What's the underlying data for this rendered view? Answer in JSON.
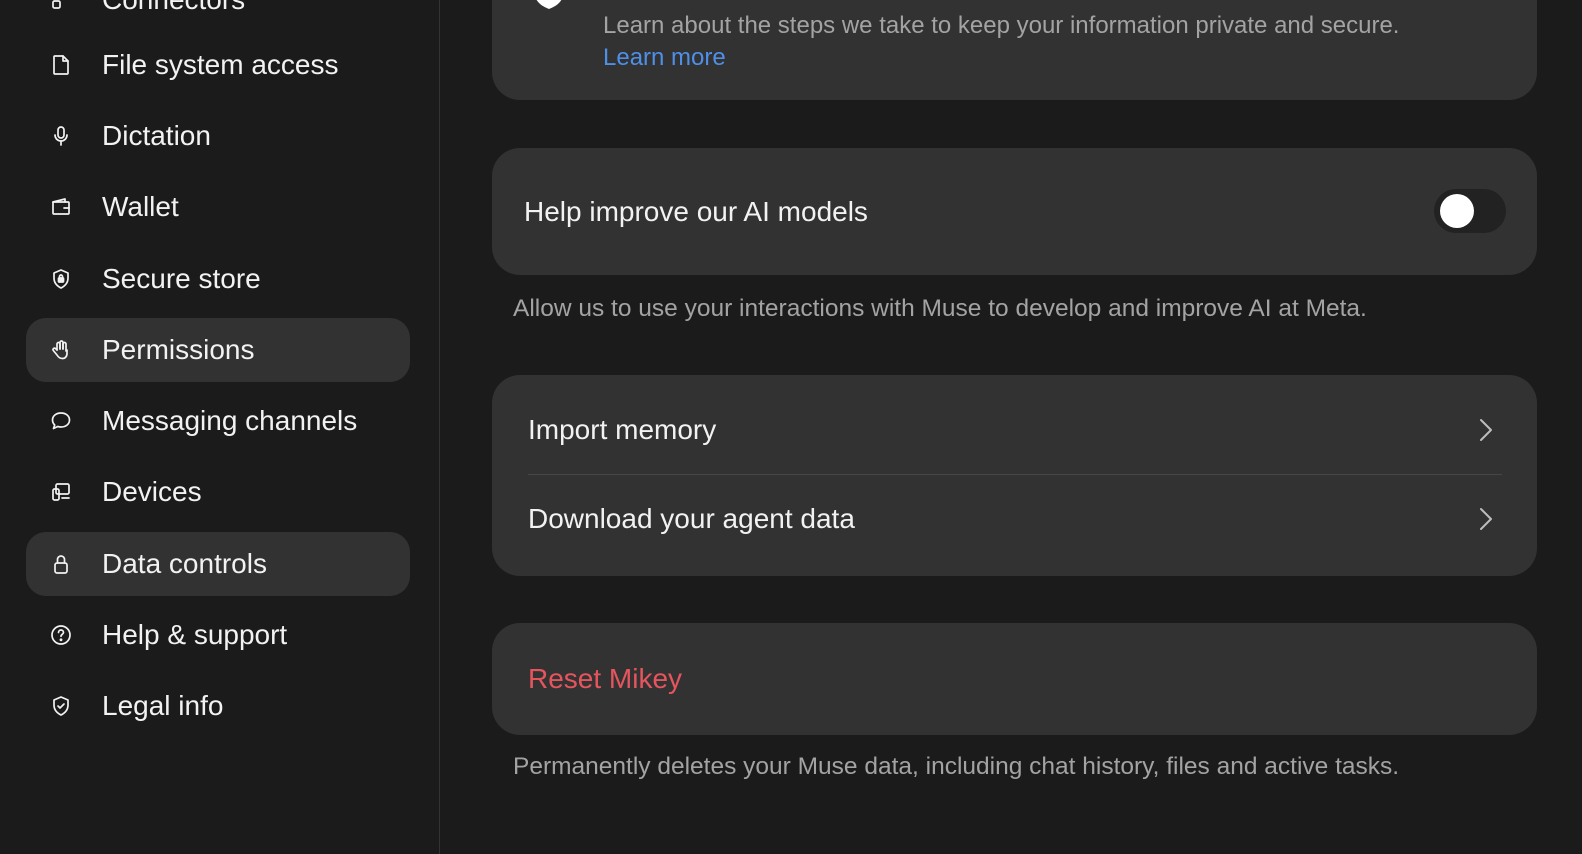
{
  "sidebar": {
    "items": [
      {
        "label": "Connectors",
        "icon": "connectors-icon"
      },
      {
        "label": "File system access",
        "icon": "file-icon"
      },
      {
        "label": "Dictation",
        "icon": "microphone-icon"
      },
      {
        "label": "Wallet",
        "icon": "wallet-icon"
      },
      {
        "label": "Secure store",
        "icon": "lock-shield-icon"
      },
      {
        "label": "Permissions",
        "icon": "hand-icon"
      },
      {
        "label": "Messaging channels",
        "icon": "chat-bubble-icon"
      },
      {
        "label": "Devices",
        "icon": "devices-icon"
      },
      {
        "label": "Data controls",
        "icon": "lock-icon"
      },
      {
        "label": "Help & support",
        "icon": "question-circle-icon"
      },
      {
        "label": "Legal info",
        "icon": "shield-check-icon"
      }
    ]
  },
  "privacy": {
    "description": "Learn about the steps we take to keep your information private and secure.",
    "link": "Learn more"
  },
  "ai_models": {
    "title": "Help improve our AI models",
    "enabled": false,
    "caption": "Allow us to use your interactions with Muse to develop and improve AI at Meta."
  },
  "data_menu": {
    "import_memory": "Import memory",
    "download_data": "Download your agent data"
  },
  "reset": {
    "label": "Reset Mikey",
    "caption": "Permanently deletes your Muse data, including chat history, files and active tasks."
  },
  "colors": {
    "background": "#1b1b1b",
    "card": "#323232",
    "link": "#4e8fe8",
    "danger": "#e5555e",
    "muted_text": "#a3a3a3"
  }
}
